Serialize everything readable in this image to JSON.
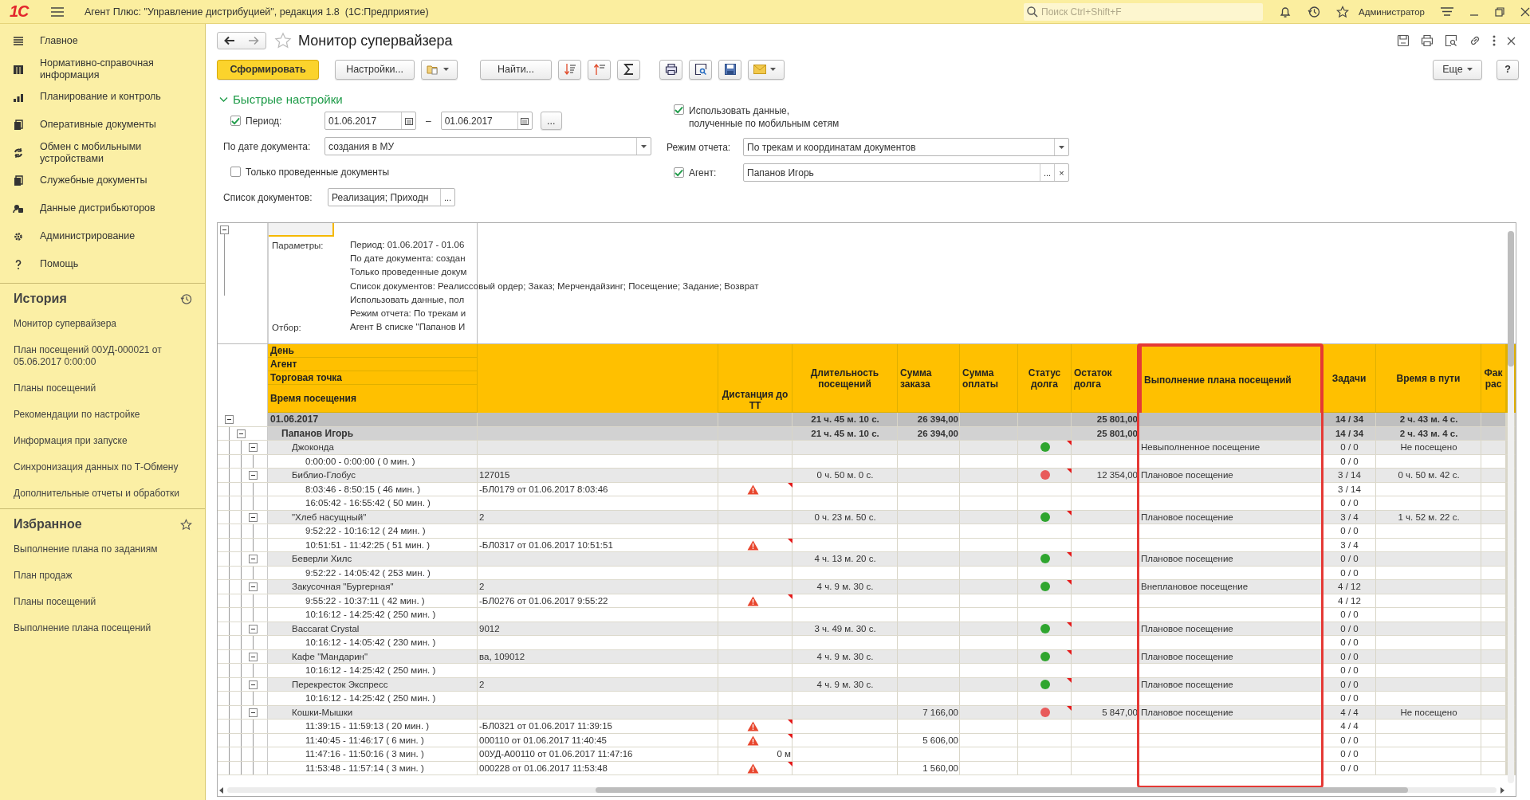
{
  "window": {
    "logo": "1С",
    "title": "Агент Плюс: \"Управление дистрибуцией\", редакция 1.8  (1С:Предприятие)",
    "search_placeholder": "Поиск Ctrl+Shift+F",
    "user": "Администратор"
  },
  "sidebar": {
    "sections": [
      {
        "label": "Главное"
      },
      {
        "label": "Нормативно-справочная информация"
      },
      {
        "label": "Планирование и контроль"
      },
      {
        "label": "Оперативные документы"
      },
      {
        "label": "Обмен с мобильными устройствами"
      },
      {
        "label": "Служебные документы"
      },
      {
        "label": "Данные дистрибьюторов"
      },
      {
        "label": "Администрирование"
      },
      {
        "label": "Помощь"
      }
    ],
    "history": {
      "title": "История",
      "items": [
        "Монитор супервайзера",
        "План посещений 00УД-000021 от 05.06.2017 0:00:00",
        "Планы посещений",
        "Рекомендации по настройке",
        "Информация при запуске",
        "Синхронизация данных по Т-Обмену",
        "Дополнительные отчеты и обработки"
      ]
    },
    "favorites": {
      "title": "Избранное",
      "items": [
        "Выполнение плана по заданиям",
        "План продаж",
        "Планы посещений",
        "Выполнение плана посещений"
      ]
    }
  },
  "form": {
    "title": "Монитор супервайзера",
    "favorite": false,
    "toolbar": {
      "generate": "Сформировать",
      "settings": "Настройки...",
      "find": "Найти...",
      "more": "Еще",
      "help": "?"
    },
    "quick_settings": {
      "title": "Быстрые настройки",
      "expanded": true,
      "period": {
        "label": "Период:",
        "checked": true,
        "from": "01.06.2017",
        "to": "01.06.2017",
        "dash": "–",
        "more": "..."
      },
      "by_date": {
        "label": "По дате документа:",
        "value": "создания в МУ"
      },
      "only_posted": {
        "label": "Только проведенные документы",
        "checked": false
      },
      "doc_list": {
        "label": "Список документов:",
        "value": "Реализация; Приходн",
        "more": "..."
      },
      "use_mobile": {
        "label_lines": [
          "Использовать данные,",
          "полученные по мобильным сетям"
        ],
        "checked": true
      },
      "report_mode": {
        "label": "Режим отчета:",
        "value": "По трекам и координатам документов"
      },
      "agent": {
        "label": "Агент:",
        "checked": true,
        "value": "Папанов Игорь",
        "more": "...",
        "clear": "×"
      }
    }
  },
  "report": {
    "expanded": true,
    "params": [
      {
        "label": "Параметры:",
        "values": [
          "Период: 01.06.2017 - 01.06",
          "По дате документа: создан",
          "Только проведенные докум",
          "Список документов: Реалиссовый ордер; Заказ; Мерчендайзинг; Посещение; Задание; Возврат",
          "Использовать данные, пол",
          "Режим отчета: По трекам и"
        ]
      },
      {
        "label": "Отбор:",
        "values": [
          "Агент В списке \"Папанов И"
        ]
      }
    ],
    "header": {
      "levels": [
        "День",
        "Агент",
        "Торговая точка",
        "Время посещения"
      ],
      "distance": "Дистанция до ТТ",
      "columns": [
        {
          "label": "Длительность посещений",
          "highlighted": false
        },
        {
          "label": "Сумма заказа",
          "highlighted": false
        },
        {
          "label": "Сумма оплаты",
          "highlighted": false
        },
        {
          "label": "Статус долга",
          "highlighted": false
        },
        {
          "label": "Остаток долга",
          "highlighted": false
        },
        {
          "label": "Выполнение плана посещений",
          "highlighted": true
        },
        {
          "label": "Задачи",
          "highlighted": false
        },
        {
          "label": "Время в пути",
          "highlighted": false
        },
        {
          "label": "Фак рас",
          "highlighted": false
        }
      ]
    },
    "rows": [
      {
        "name": "01.06.2017",
        "expanded": true,
        "duration": "21 ч. 45 м. 10 с.",
        "order_sum": "26 394,00",
        "debt_rest": "25 801,00",
        "tasks": "14 / 34",
        "travel": "2 ч. 43 м. 4 с.",
        "children": [
          {
            "name": "Папанов Игорь",
            "expanded": true,
            "duration": "21 ч. 45 м. 10 с.",
            "order_sum": "26 394,00",
            "debt_rest": "25 801,00",
            "tasks": "14 / 34",
            "travel": "2 ч. 43 м. 4 с.",
            "children": [
              {
                "name": "Джоконда",
                "expanded": true,
                "color": "#2fa52f",
                "plan": "Невыполненное посещение",
                "tasks": "0 / 0",
                "travel": "Не посещено",
                "children": [
                  {
                    "name": "0:00:00 - 0:00:00 ( 0 мин. )",
                    "warning": false,
                    "tasks": "0 / 0"
                  }
                ]
              },
              {
                "name": "Библио-Глобус",
                "expanded": true,
                "doc": "127015",
                "duration": "0 ч. 50 м. 0 с.",
                "color": "#e85a5a",
                "debt_rest": "12 354,00",
                "plan": "Плановое посещение",
                "tasks": "3 / 14",
                "travel": "0 ч. 50 м. 42 с.",
                "children": [
                  {
                    "name": "8:03:46 - 8:50:15 ( 46 мин. )",
                    "doc": "-БЛ0179 от 01.06.2017 8:03:46",
                    "warning": true,
                    "tasks": "3 / 14"
                  },
                  {
                    "name": "16:05:42 - 16:55:42 ( 50 мин. )",
                    "warning": false,
                    "tasks": "0 / 0"
                  }
                ]
              },
              {
                "name": "\"Хлеб насущный\"",
                "expanded": true,
                "doc": "2",
                "duration": "0 ч. 23 м. 50 с.",
                "color": "#2fa52f",
                "plan": "Плановое посещение",
                "tasks": "3 / 4",
                "travel": "1 ч. 52 м. 22 с.",
                "children": [
                  {
                    "name": "9:52:22 - 10:16:12 ( 24 мин. )",
                    "warning": false,
                    "tasks": "0 / 0"
                  },
                  {
                    "name": "10:51:51 - 11:42:25 ( 51 мин. )",
                    "doc": "-БЛ0317 от 01.06.2017 10:51:51",
                    "warning": true,
                    "tasks": "3 / 4"
                  }
                ]
              },
              {
                "name": "Беверли Хилс",
                "expanded": true,
                "duration": "4 ч. 13 м. 20 с.",
                "color": "#2fa52f",
                "plan": "Плановое посещение",
                "tasks": "0 / 0",
                "children": [
                  {
                    "name": "9:52:22 - 14:05:42 ( 253 мин. )",
                    "warning": false,
                    "tasks": "0 / 0"
                  }
                ]
              },
              {
                "name": "Закусочная \"Бургерная\"",
                "expanded": true,
                "doc": "2",
                "duration": "4 ч. 9 м. 30 с.",
                "color": "#2fa52f",
                "plan": "Внеплановое посещение",
                "tasks": "4 / 12",
                "children": [
                  {
                    "name": "9:55:22 - 10:37:11 ( 42 мин. )",
                    "doc": "-БЛ0276 от 01.06.2017 9:55:22",
                    "warning": true,
                    "tasks": "4 / 12"
                  },
                  {
                    "name": "10:16:12 - 14:25:42 ( 250 мин. )",
                    "warning": false,
                    "tasks": "0 / 0"
                  }
                ]
              },
              {
                "name": "Baccarat Crystal",
                "expanded": true,
                "doc": "9012",
                "duration": "3 ч. 49 м. 30 с.",
                "color": "#2fa52f",
                "plan": "Плановое посещение",
                "tasks": "0 / 0",
                "children": [
                  {
                    "name": "10:16:12 - 14:05:42 ( 230 мин. )",
                    "warning": false,
                    "tasks": "0 / 0"
                  }
                ]
              },
              {
                "name": "Кафе \"Мандарин\"",
                "expanded": true,
                "doc": "ва, 109012",
                "duration": "4 ч. 9 м. 30 с.",
                "color": "#2fa52f",
                "plan": "Плановое посещение",
                "tasks": "0 / 0",
                "children": [
                  {
                    "name": "10:16:12 - 14:25:42 ( 250 мин. )",
                    "warning": false,
                    "tasks": "0 / 0"
                  }
                ]
              },
              {
                "name": "Перекресток Экспресс",
                "expanded": true,
                "doc": "2",
                "duration": "4 ч. 9 м. 30 с.",
                "color": "#2fa52f",
                "plan": "Плановое посещение",
                "tasks": "0 / 0",
                "children": [
                  {
                    "name": "10:16:12 - 14:25:42 ( 250 мин. )",
                    "warning": false,
                    "tasks": "0 / 0"
                  }
                ]
              },
              {
                "name": "Кошки-Мышки",
                "expanded": true,
                "order_sum": "7 166,00",
                "color": "#e85a5a",
                "debt_rest": "5 847,00",
                "plan": "Плановое посещение",
                "tasks": "4 / 4",
                "travel": "Не посещено",
                "children": [
                  {
                    "name": "11:39:15 - 11:59:13 ( 20 мин. )",
                    "doc": "-БЛ0321 от 01.06.2017 11:39:15",
                    "warning": true,
                    "tasks": "4 / 4"
                  },
                  {
                    "name": "11:40:45 - 11:46:17 ( 6 мин. )",
                    "doc": "000110 от 01.06.2017 11:40:45",
                    "warning": true,
                    "order_sum": "5 606,00",
                    "tasks": "0 / 0"
                  },
                  {
                    "name": "11:47:16 - 11:50:16 ( 3 мин. )",
                    "doc": "00УД-А00110 от 01.06.2017 11:47:16",
                    "warning": false,
                    "distance": "0 м",
                    "tasks": "0 / 0"
                  },
                  {
                    "name": "11:53:48 - 11:57:14 ( 3 мин. )",
                    "doc": "000228 от 01.06.2017 11:53:48",
                    "warning": true,
                    "order_sum": "1 560,00",
                    "tasks": "0 / 0"
                  }
                ]
              }
            ]
          }
        ]
      }
    ]
  }
}
